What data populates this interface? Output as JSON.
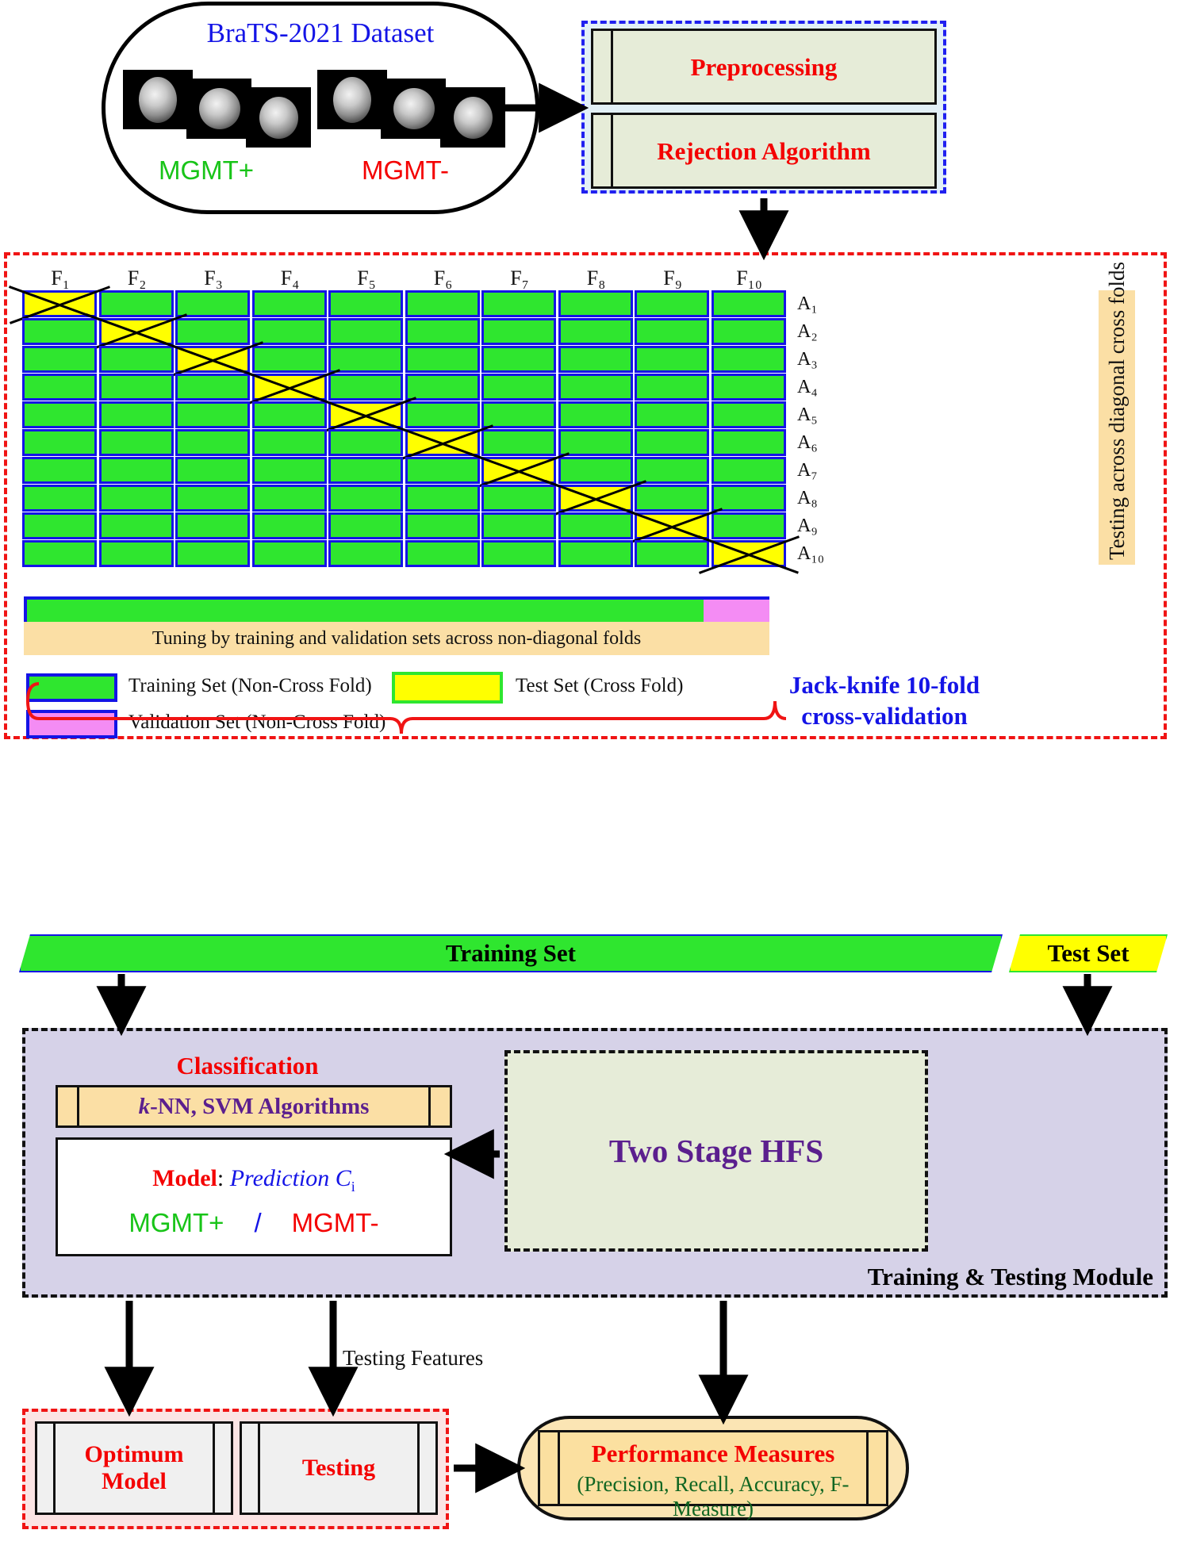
{
  "dataset": {
    "title": "BraTS-2021 Dataset",
    "class_positive": "MGMT+",
    "class_negative": "MGMT-",
    "positive_color": "#18c418",
    "negative_color": "#f40000"
  },
  "preprocessing": {
    "step1": "Preprocessing",
    "step2": "Rejection Algorithm",
    "border_color": "#2020f0",
    "fill_color": "#e2f0f7",
    "inner_fill": "#e6ecd8",
    "text_color": "#f40000"
  },
  "cross_validation": {
    "fold_headers": [
      "F₁",
      "F₂",
      "F₃",
      "F₄",
      "F₅",
      "F₆",
      "F₇",
      "F₈",
      "F₉",
      "F₁₀"
    ],
    "row_headers": [
      "A₁",
      "A₂",
      "A₃",
      "A₄",
      "A₅",
      "A₆",
      "A₇",
      "A₈",
      "A₉",
      "A₁₀"
    ],
    "vertical_band_text": "Testing across diagonal cross folds",
    "tuning_caption": "Tuning by training and validation sets across non-diagonal folds",
    "title": "Jack-knife 10-fold cross-validation",
    "title_line1": "Jack-knife 10-fold",
    "title_line2": "cross-validation",
    "legend": [
      {
        "label": "Training Set (Non-Cross Fold)",
        "color": "#2fe62f",
        "kind": "solid"
      },
      {
        "label": "Test Set (Cross Fold)",
        "color": "#ffff00",
        "kind": "cross"
      },
      {
        "label": "Validation Set (Non-Cross Fold)",
        "color": "#f48cf4",
        "kind": "solid"
      }
    ],
    "training_color": "#2fe62f",
    "test_color": "#ffff00",
    "validation_color": "#f48cf4",
    "cell_border_color": "#1414e6",
    "container_border_color": "#f01414",
    "n_folds": 10
  },
  "banner": {
    "training": "Training Set",
    "test": "Test Set"
  },
  "module": {
    "label": "Training & Testing Module",
    "classification_title": "Classification",
    "algorithms_prefix": "k",
    "algorithms_rest": "-NN, SVM Algorithms",
    "model_prefix": "Model",
    "model_sep": ": ",
    "model_value": "Prediction C",
    "model_value_sub": "i",
    "out_positive": "MGMT+",
    "out_sep": "/",
    "out_negative": "MGMT-",
    "hfs": "Two Stage HFS",
    "hfs_color": "#5b1f8e",
    "module_fill": "#d6d2e8"
  },
  "bottom": {
    "optimum_model_line1": "Optimum",
    "optimum_model_line2": "Model",
    "testing": "Testing",
    "testing_features_label": "Testing Features",
    "performance_title": "Performance Measures",
    "performance_metrics": "(Precision, Recall, Accuracy, F-Measure)",
    "performance_fill": "#fbe5b4",
    "metrics_color": "#116622"
  }
}
